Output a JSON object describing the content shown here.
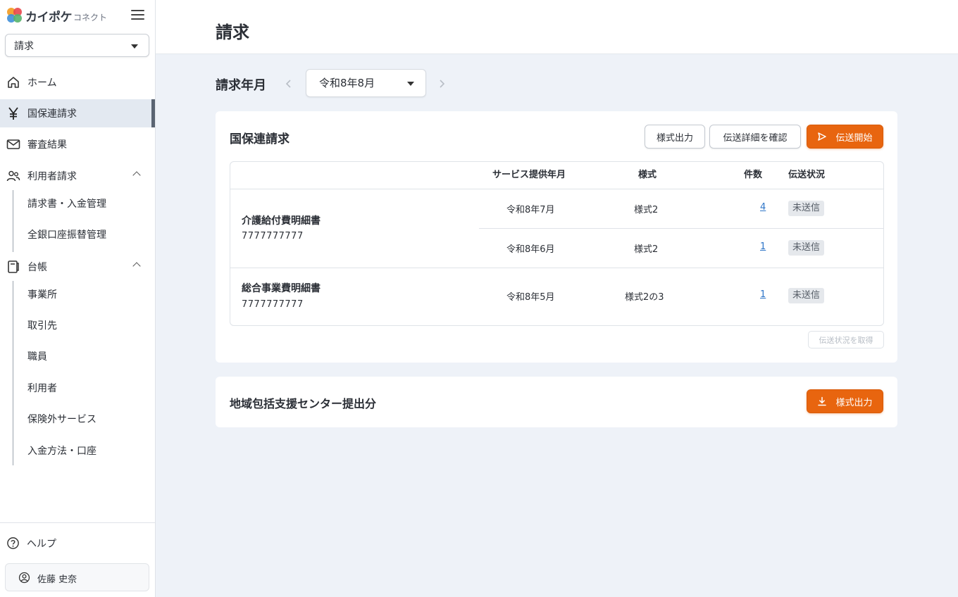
{
  "brand": {
    "name": "カイポケ",
    "sub": "コネクト"
  },
  "sidebar": {
    "module_select": "請求",
    "items": [
      {
        "label": "ホーム",
        "icon": "home-icon"
      },
      {
        "label": "国保連請求",
        "icon": "yen-icon",
        "active": true
      },
      {
        "label": "審査結果",
        "icon": "mail-icon"
      },
      {
        "label": "利用者請求",
        "icon": "users-icon",
        "expanded": true
      },
      {
        "label": "台帳",
        "icon": "ledger-icon",
        "expanded": true
      }
    ],
    "billing_sub": [
      "請求書・入金管理",
      "全銀口座振替管理"
    ],
    "ledger_sub": [
      "事業所",
      "取引先",
      "職員",
      "利用者",
      "保険外サービス",
      "入金方法・口座"
    ],
    "help": "ヘルプ",
    "user": "佐藤 史奈"
  },
  "header": {
    "title": "請求"
  },
  "period": {
    "label": "請求年月",
    "value": "令和8年8月"
  },
  "kokuho": {
    "title": "国保連請求",
    "buttons": {
      "export": "様式出力",
      "detail": "伝送詳細を確認",
      "start": "伝送開始"
    },
    "columns": {
      "service_month": "サービス提供年月",
      "form": "様式",
      "count": "件数",
      "status": "伝送状況"
    },
    "groups": [
      {
        "name": "介護給付費明細書",
        "code": "7777777777",
        "rows": [
          {
            "month": "令和8年7月",
            "form": "様式2",
            "count": "4",
            "status": "未送信"
          },
          {
            "month": "令和8年6月",
            "form": "様式2",
            "count": "1",
            "status": "未送信"
          }
        ]
      },
      {
        "name": "総合事業費明細書",
        "code": "7777777777",
        "rows": [
          {
            "month": "令和8年5月",
            "form": "様式2の3",
            "count": "1",
            "status": "未送信"
          }
        ]
      }
    ],
    "fetch_status": "伝送状況を取得"
  },
  "chiiki": {
    "title": "地域包括支援センター提出分",
    "export": "様式出力"
  },
  "colors": {
    "accent": "#e8650f",
    "link": "#2f76c8",
    "background": "#eef2f8"
  }
}
